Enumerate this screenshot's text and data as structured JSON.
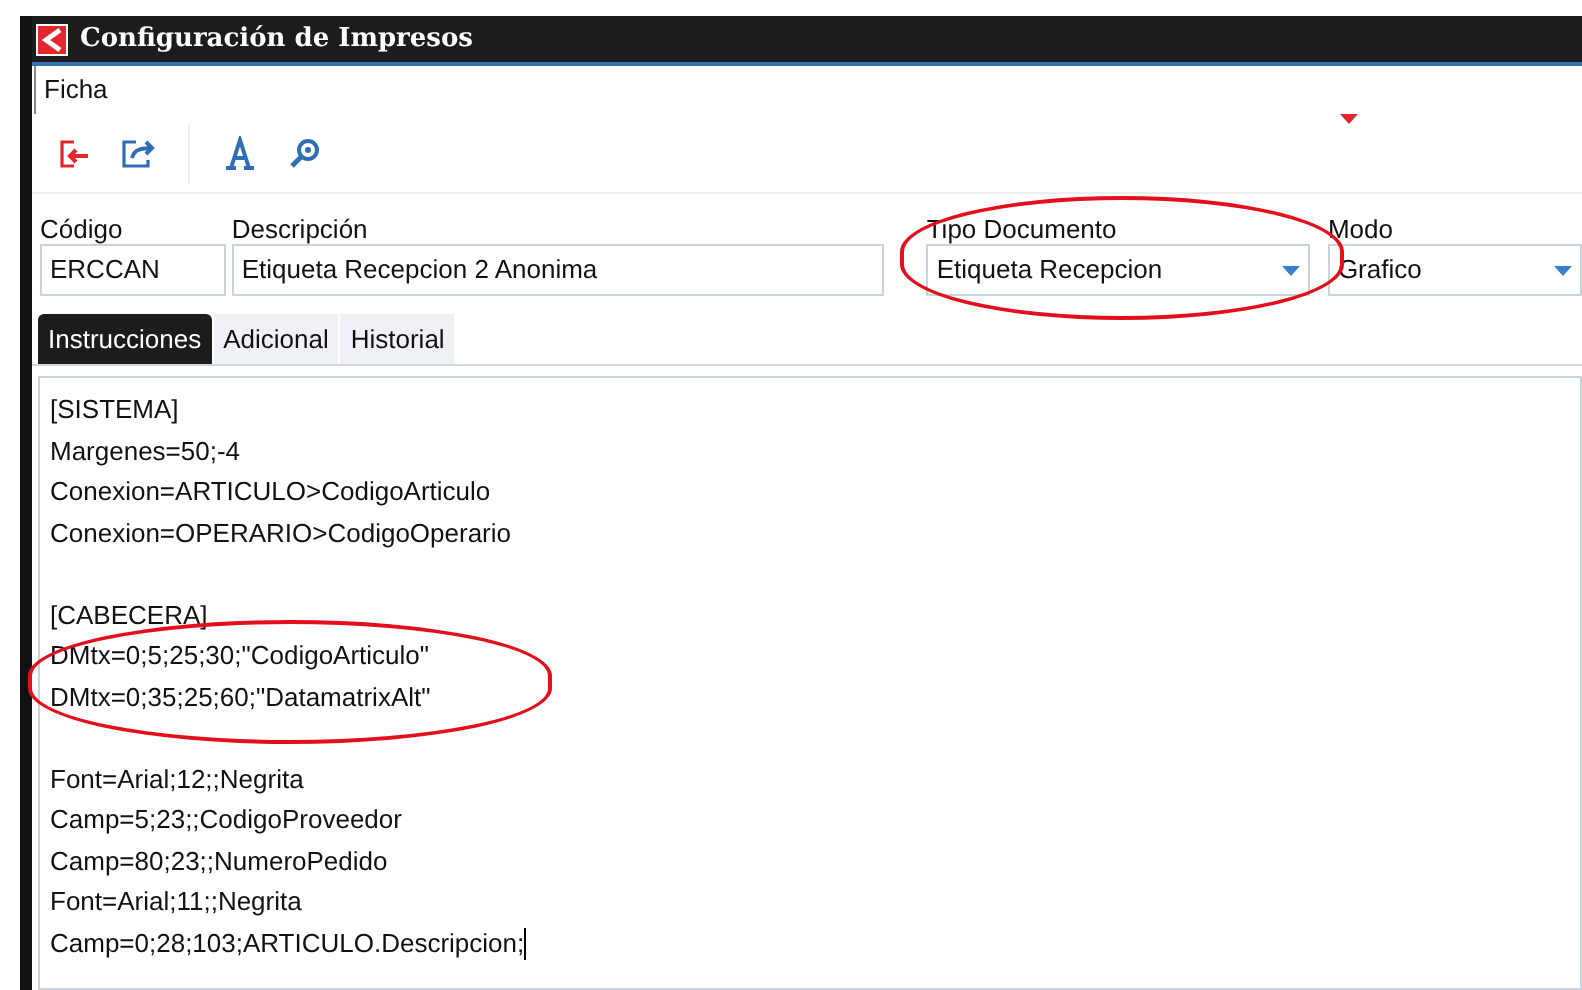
{
  "window": {
    "title": "Configuración de Impresos"
  },
  "menu": [
    "Ficha"
  ],
  "fields": [
    {
      "label": "Código",
      "value": "ERCCAN",
      "kind": "text"
    },
    {
      "label": "Descripción",
      "value": "Etiqueta Recepcion 2 Anonima",
      "kind": "text"
    },
    {
      "label": "Tipo Documento",
      "value": "Etiqueta Recepcion",
      "kind": "select"
    },
    {
      "label": "Modo",
      "value": "Grafico",
      "kind": "select"
    }
  ],
  "tabs": [
    {
      "label": "Instrucciones",
      "selected": true
    },
    {
      "label": "Adicional",
      "selected": false
    },
    {
      "label": "Historial",
      "selected": false
    }
  ],
  "editor": {
    "sections": [
      {
        "lines": [
          "[SISTEMA]",
          "Margenes=50;-4",
          "Conexion=ARTICULO>CodigoArticulo",
          "Conexion=OPERARIO>CodigoOperario"
        ]
      },
      {
        "lines": [
          "[CABECERA]",
          "DMtx=0;5;25;30;\"CodigoArticulo\"",
          "DMtx=0;35;25;60;\"DatamatrixAlt\""
        ]
      },
      {
        "lines": [
          "Font=Arial;12;;Negrita",
          "Camp=5;23;;CodigoProveedor",
          "Camp=80;23;;NumeroPedido",
          "Font=Arial;11;;Negrita",
          "Camp=0;28;103;ARTICULO.Descripcion;"
        ]
      }
    ]
  }
}
